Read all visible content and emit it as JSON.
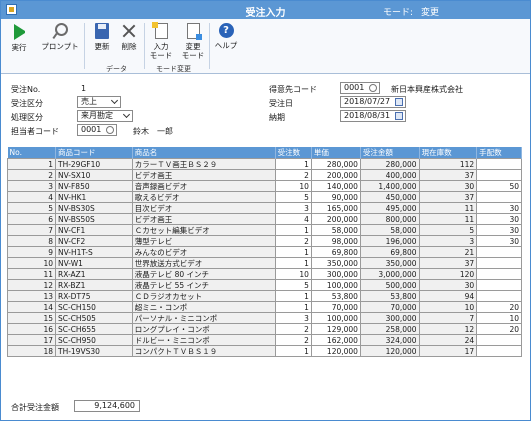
{
  "window": {
    "title": "受注入力",
    "mode_label": "モード:",
    "mode_value": "変更"
  },
  "ribbon": {
    "run": "実行",
    "prompt": "プロンプト",
    "update": "更新",
    "delete": "削除",
    "group_data": "データ",
    "input_mode_1": "入力",
    "input_mode_2": "モード",
    "change_mode_1": "変更",
    "change_mode_2": "モード",
    "group_mode": "モード変更",
    "help": "ヘルプ",
    "icons": [
      "play-icon",
      "search-icon",
      "save-icon",
      "delete-icon",
      "input-mode-icon",
      "change-mode-icon",
      "help-icon"
    ]
  },
  "form": {
    "order_no_label": "受注No.",
    "order_no_value": "1",
    "order_type_label": "受注区分",
    "order_type_value": "売上",
    "process_type_label": "処理区分",
    "process_type_value": "来月勘定",
    "staff_code_label": "担当者コード",
    "staff_code_value": "0001",
    "staff_name": "鈴木　一郎",
    "customer_code_label": "得意先コード",
    "customer_code_value": "0001",
    "customer_name": "新日本興産株式会社",
    "order_date_label": "受注日",
    "order_date_value": "2018/07/27",
    "delivery_date_label": "納期",
    "delivery_date_value": "2018/08/31"
  },
  "table": {
    "headers": [
      "No.",
      "商品コード",
      "商品名",
      "受注数",
      "単価",
      "受注金額",
      "現在庫数",
      "手配数"
    ],
    "rows": [
      [
        "1",
        "TH-29GF10",
        "カラーＴＶ画王ＢＳ２９",
        "1",
        "280,000",
        "280,000",
        "112",
        ""
      ],
      [
        "2",
        "NV-SX10",
        "ビデオ画王",
        "2",
        "200,000",
        "400,000",
        "37",
        ""
      ],
      [
        "3",
        "NV-F850",
        "音声録画ビデオ",
        "10",
        "140,000",
        "1,400,000",
        "30",
        "50"
      ],
      [
        "4",
        "NV-HK1",
        "歌えるビデオ",
        "5",
        "90,000",
        "450,000",
        "37",
        ""
      ],
      [
        "5",
        "NV-BS30S",
        "目次ビデオ",
        "3",
        "165,000",
        "495,000",
        "11",
        "30"
      ],
      [
        "6",
        "NV-BS50S",
        "ビデオ画王",
        "4",
        "200,000",
        "800,000",
        "11",
        "30"
      ],
      [
        "7",
        "NV-CF1",
        "Ｃカセット編集ビデオ",
        "1",
        "58,000",
        "58,000",
        "5",
        "30"
      ],
      [
        "8",
        "NV-CF2",
        "薄型テレビ",
        "2",
        "98,000",
        "196,000",
        "3",
        "30"
      ],
      [
        "9",
        "NV-H1T-S",
        "みんなのビデオ",
        "1",
        "69,800",
        "69,800",
        "21",
        ""
      ],
      [
        "10",
        "NV-W1",
        "世界放送方式ビデオ",
        "1",
        "350,000",
        "350,000",
        "37",
        ""
      ],
      [
        "11",
        "RX-AZ1",
        "液晶テレビ 80 インチ",
        "10",
        "300,000",
        "3,000,000",
        "120",
        ""
      ],
      [
        "12",
        "RX-BZ1",
        "液晶テレビ 55 インチ",
        "5",
        "100,000",
        "500,000",
        "30",
        ""
      ],
      [
        "13",
        "RX-DT75",
        "ＣＤラジオカセット",
        "1",
        "53,800",
        "53,800",
        "94",
        ""
      ],
      [
        "14",
        "SC-CH150",
        "超ミニ・コンポ",
        "1",
        "70,000",
        "70,000",
        "10",
        "20"
      ],
      [
        "15",
        "SC-CH505",
        "パーソナル・ミニコンポ",
        "3",
        "100,000",
        "300,000",
        "7",
        "10"
      ],
      [
        "16",
        "SC-CH655",
        "ロングプレイ・コンポ",
        "2",
        "129,000",
        "258,000",
        "12",
        "20"
      ],
      [
        "17",
        "SC-CH950",
        "ドルビー・ミニコンポ",
        "2",
        "162,000",
        "324,000",
        "24",
        ""
      ],
      [
        "18",
        "TH-19VS30",
        "コンパクトＴＶＢＳ１９",
        "1",
        "120,000",
        "120,000",
        "17",
        ""
      ]
    ]
  },
  "footer": {
    "total_label": "合計受注金額",
    "total_value": "9,124,600"
  },
  "colors": {
    "accent": "#5b97d4",
    "header_text": "#ffffff"
  }
}
